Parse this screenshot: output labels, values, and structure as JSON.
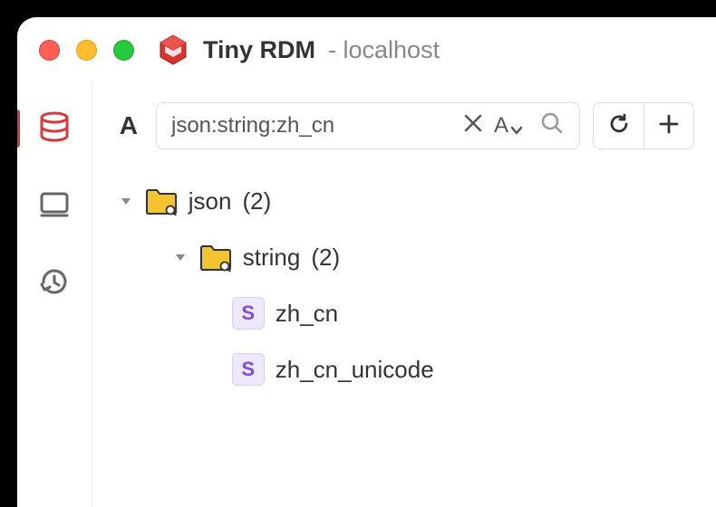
{
  "titlebar": {
    "app_name": "Tiny RDM",
    "connection_label": "- localhost"
  },
  "sidebar": {
    "items": [
      {
        "name": "database",
        "active": true
      },
      {
        "name": "server",
        "active": false
      },
      {
        "name": "history",
        "active": false
      }
    ]
  },
  "toolbar": {
    "filter_letter": "A",
    "search_value": "json:string:zh_cn",
    "sort_letter": "A"
  },
  "tree": {
    "nodes": [
      {
        "type": "folder",
        "label": "json",
        "count": "(2)",
        "level": 0,
        "expanded": true
      },
      {
        "type": "folder",
        "label": "string",
        "count": "(2)",
        "level": 1,
        "expanded": true
      },
      {
        "type": "key",
        "label": "zh_cn",
        "badge": "S",
        "level": 2
      },
      {
        "type": "key",
        "label": "zh_cn_unicode",
        "badge": "S",
        "level": 2
      }
    ]
  }
}
